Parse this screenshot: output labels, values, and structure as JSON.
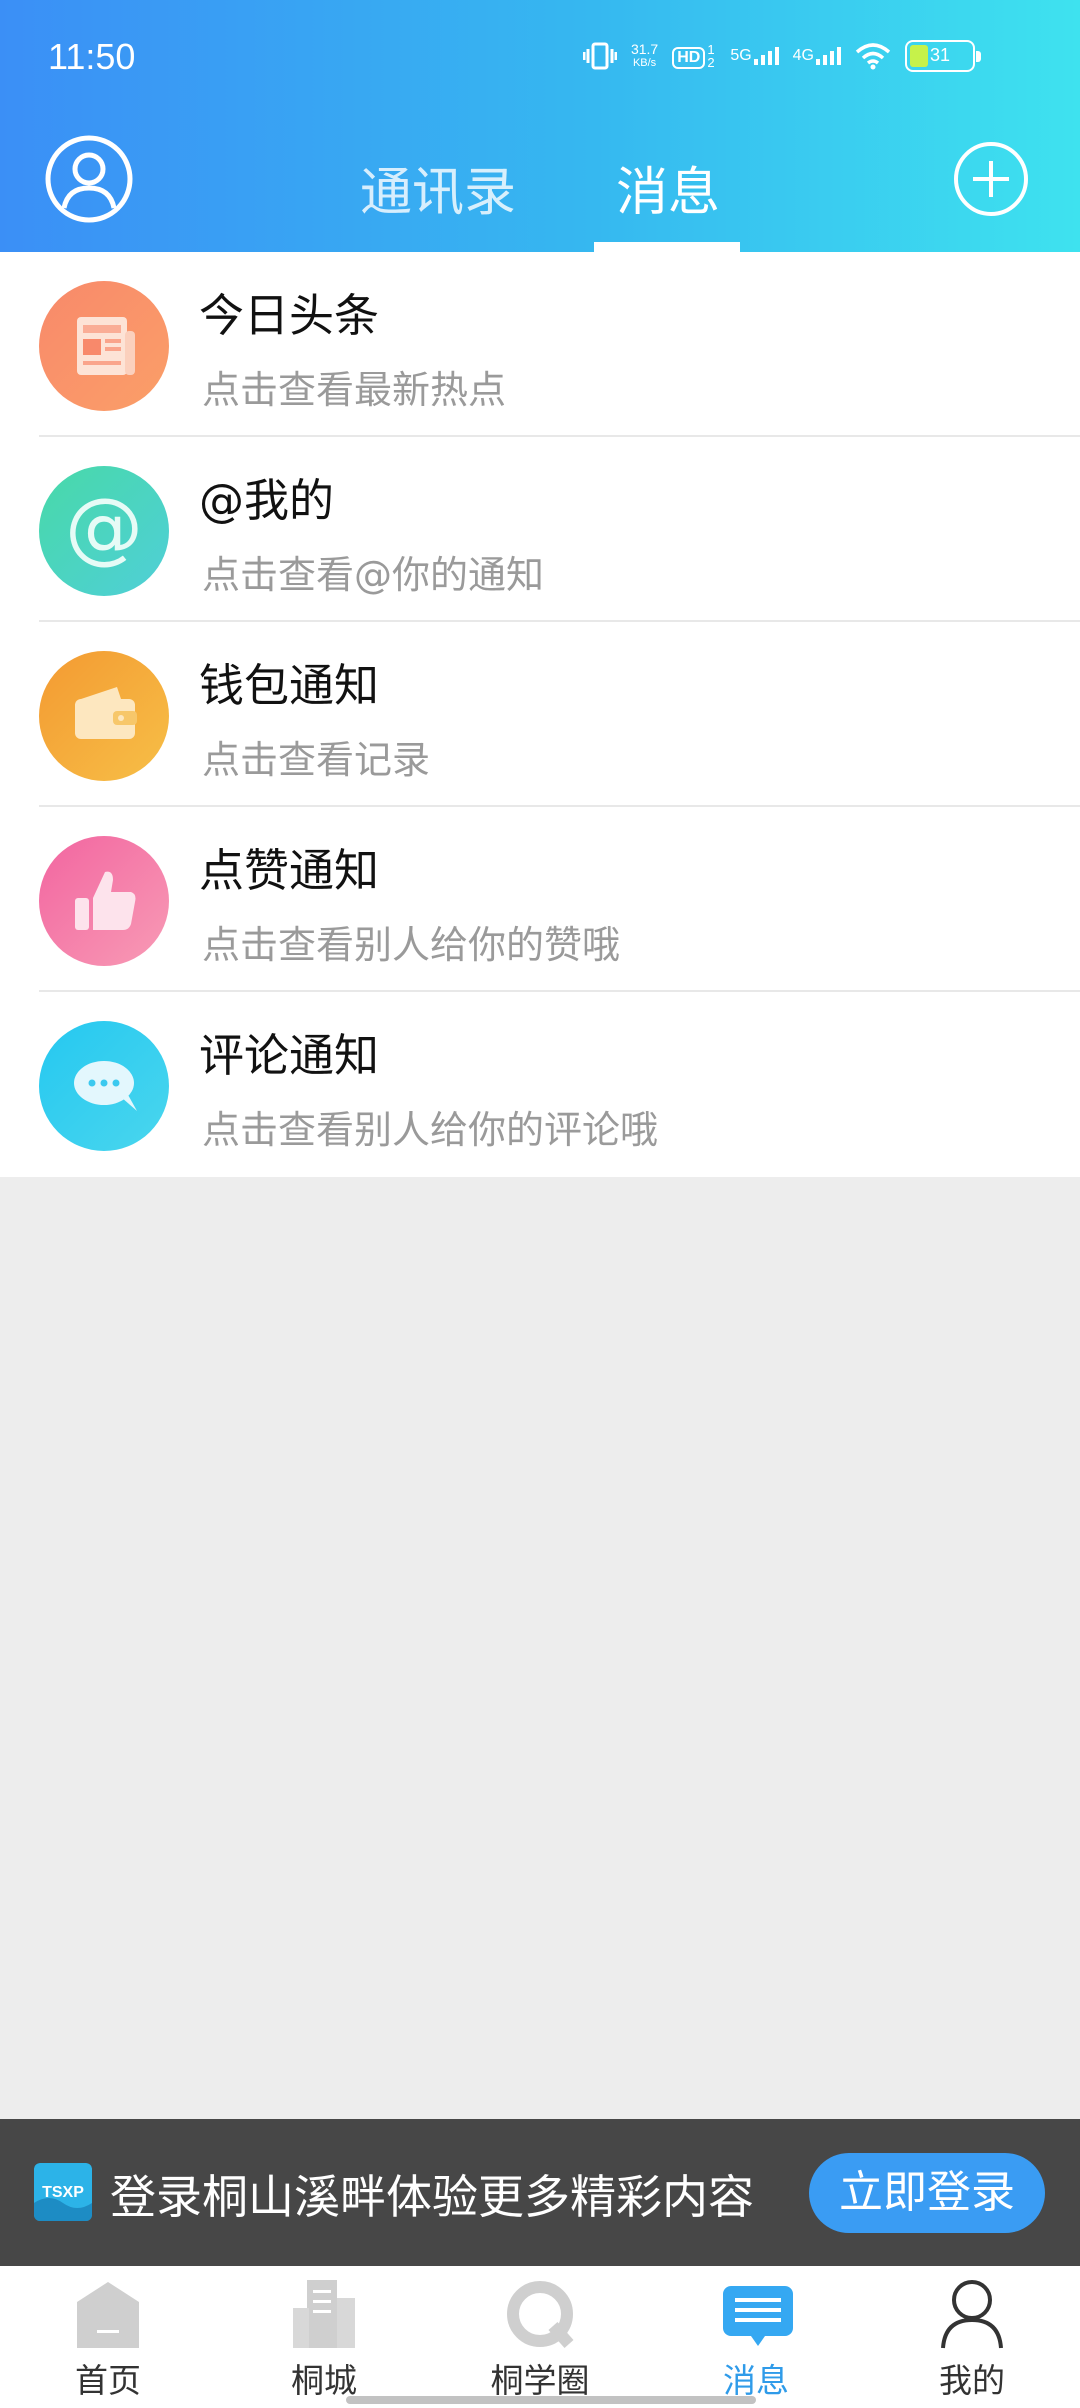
{
  "status_bar": {
    "time": "11:50",
    "net_speed_value": "31.7",
    "net_speed_unit": "KB/s",
    "hd_label": "HD",
    "hd_sub": "12",
    "network_5g": "5G",
    "network_4g": "4G",
    "battery": "31"
  },
  "header": {
    "tabs": [
      {
        "label": "通讯录"
      },
      {
        "label": "消息"
      }
    ],
    "active_tab": "消息"
  },
  "messages": [
    {
      "title": "今日头条",
      "subtitle": "点击查看最新热点",
      "icon": "newspaper-icon",
      "color": "#f8896b"
    },
    {
      "title": "@我的",
      "subtitle": "点击查看@你的通知",
      "icon": "at-icon",
      "color": "#44d6b8"
    },
    {
      "title": "钱包通知",
      "subtitle": "点击查看记录",
      "icon": "wallet-icon",
      "color": "#f5a83a"
    },
    {
      "title": "点赞通知",
      "subtitle": "点击查看别人给你的赞哦",
      "icon": "thumbs-up-icon",
      "color": "#f36fa0"
    },
    {
      "title": "评论通知",
      "subtitle": "点击查看别人给你的评论哦",
      "icon": "comment-icon",
      "color": "#2ecdf0"
    }
  ],
  "login_banner": {
    "logo_text": "TSXP",
    "text": "登录桐山溪畔体验更多精彩内容",
    "button": "立即登录"
  },
  "bottom_nav": {
    "items": [
      {
        "label": "首页",
        "icon": "home-icon"
      },
      {
        "label": "桐城",
        "icon": "city-icon"
      },
      {
        "label": "桐学圈",
        "icon": "circle-icon"
      },
      {
        "label": "消息",
        "icon": "message-icon"
      },
      {
        "label": "我的",
        "icon": "profile-icon"
      }
    ],
    "active": "消息"
  },
  "colors": {
    "header_gradient_start": "#3b8ff6",
    "header_gradient_end": "#3ee2ef",
    "accent": "#2f9be9",
    "login_button": "#3a9cf3"
  }
}
